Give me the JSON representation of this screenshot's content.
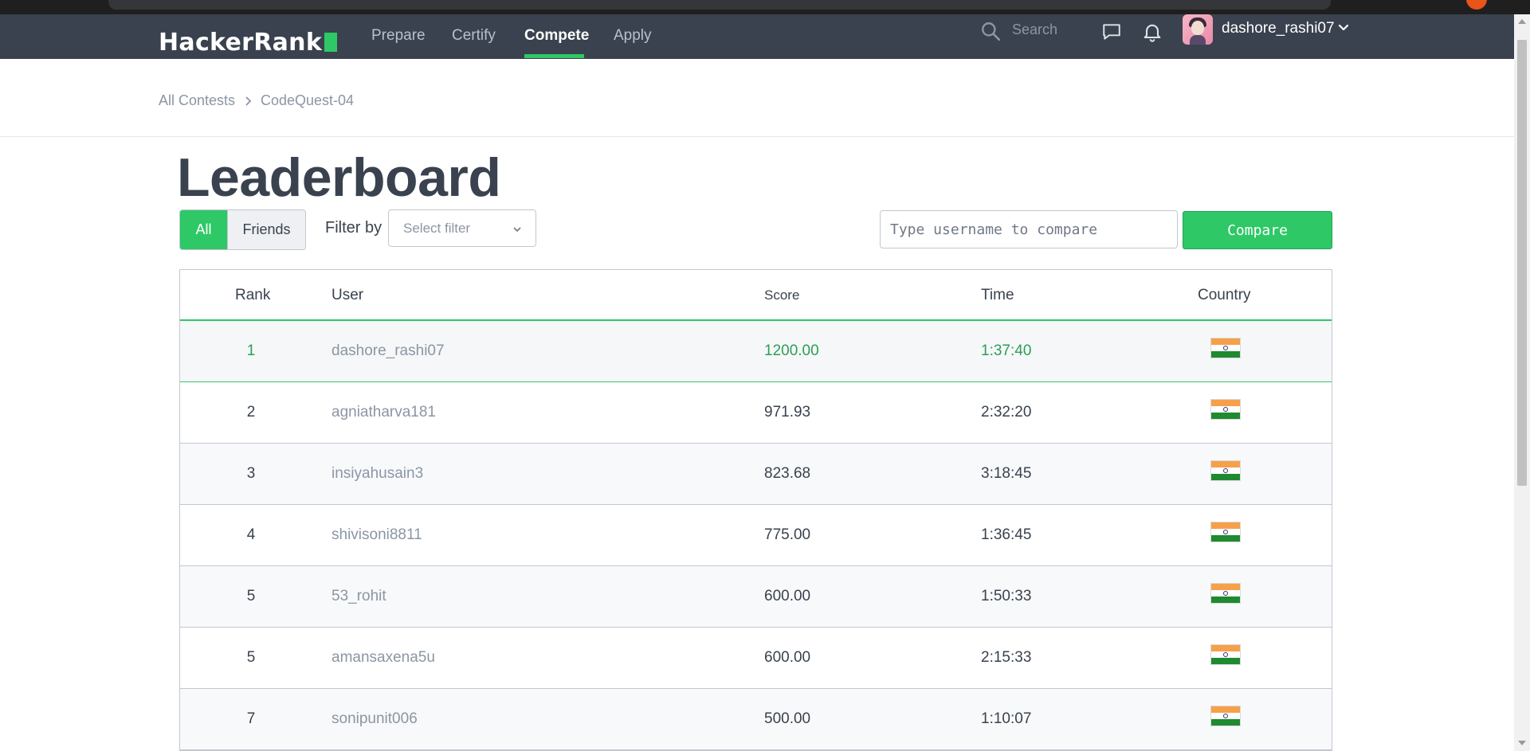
{
  "nav": {
    "logo": "HackerRank",
    "links": [
      "Prepare",
      "Certify",
      "Compete",
      "Apply"
    ],
    "active": "Compete",
    "search_placeholder": "Search",
    "username": "dashore_rashi07",
    "accent_color": "#2ec866"
  },
  "breadcrumb": [
    "All Contests",
    "CodeQuest-04"
  ],
  "page_title": "Leaderboard",
  "filters": {
    "all_label": "All",
    "friends_label": "Friends",
    "filter_by_label": "Filter by",
    "select_placeholder": "Select filter"
  },
  "compare": {
    "placeholder": "Type username to compare",
    "button_label": "Compare"
  },
  "table": {
    "headers": [
      "Rank",
      "User",
      "Score",
      "Time",
      "Country"
    ],
    "rows": [
      {
        "rank": "1",
        "user": "dashore_rashi07",
        "score": "1200.00",
        "time": "1:37:40",
        "country": "India flag"
      },
      {
        "rank": "2",
        "user": "agniatharva181",
        "score": "971.93",
        "time": "2:32:20",
        "country": "India flag"
      },
      {
        "rank": "3",
        "user": "insiyahusain3",
        "score": "823.68",
        "time": "3:18:45",
        "country": "India flag"
      },
      {
        "rank": "4",
        "user": "shivisoni8811",
        "score": "775.00",
        "time": "1:36:45",
        "country": "India flag"
      },
      {
        "rank": "5",
        "user": "53_rohit",
        "score": "600.00",
        "time": "1:50:33",
        "country": "India flag"
      },
      {
        "rank": "5",
        "user": "amansaxena5u",
        "score": "600.00",
        "time": "2:15:33",
        "country": "India flag"
      },
      {
        "rank": "7",
        "user": "sonipunit006",
        "score": "500.00",
        "time": "1:10:07",
        "country": "India flag"
      }
    ]
  }
}
